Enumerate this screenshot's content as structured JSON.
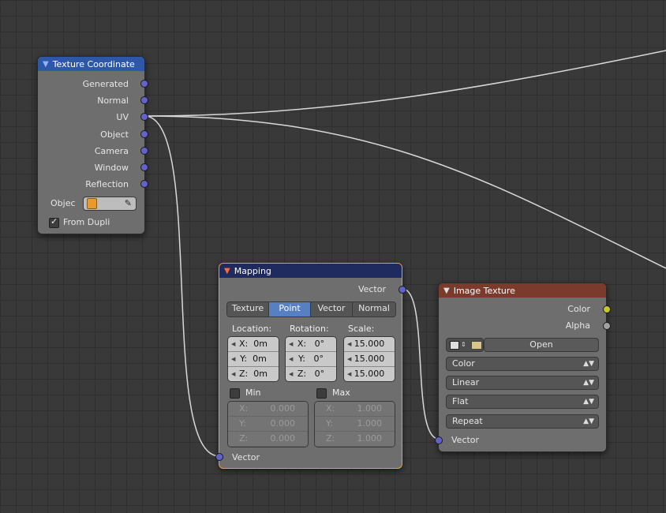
{
  "texture_coordinate": {
    "title": "Texture Coordinate",
    "outputs": [
      "Generated",
      "Normal",
      "UV",
      "Object",
      "Camera",
      "Window",
      "Reflection"
    ],
    "object_label": "Objec",
    "from_dupli_label": "From Dupli",
    "from_dupli_checked": true
  },
  "mapping": {
    "title": "Mapping",
    "output_label": "Vector",
    "input_label": "Vector",
    "types": [
      "Texture",
      "Point",
      "Vector",
      "Normal"
    ],
    "active_type": "Point",
    "location_label": "Location:",
    "rotation_label": "Rotation:",
    "scale_label": "Scale:",
    "location": [
      {
        "axis": "X:",
        "value": "0m"
      },
      {
        "axis": "Y:",
        "value": "0m"
      },
      {
        "axis": "Z:",
        "value": "0m"
      }
    ],
    "rotation": [
      {
        "axis": "X:",
        "value": "0°"
      },
      {
        "axis": "Y:",
        "value": "0°"
      },
      {
        "axis": "Z:",
        "value": "0°"
      }
    ],
    "scale": [
      "15.000",
      "15.000",
      "15.000"
    ],
    "min_label": "Min",
    "max_label": "Max",
    "min": [
      {
        "axis": "X:",
        "value": "0.000"
      },
      {
        "axis": "Y:",
        "value": "0.000"
      },
      {
        "axis": "Z:",
        "value": "0.000"
      }
    ],
    "max": [
      {
        "axis": "X:",
        "value": "1.000"
      },
      {
        "axis": "Y:",
        "value": "1.000"
      },
      {
        "axis": "Z:",
        "value": "1.000"
      }
    ]
  },
  "image_texture": {
    "title": "Image Texture",
    "outputs": [
      "Color",
      "Alpha"
    ],
    "open_label": "Open",
    "color_space": "Color",
    "interpolation": "Linear",
    "projection": "Flat",
    "extension": "Repeat",
    "input_label": "Vector"
  },
  "colors": {
    "vector_socket": "#6363c7",
    "color_socket": "#c7c729",
    "selected_outline": "#f0a030",
    "active_button": "#5680c2"
  }
}
